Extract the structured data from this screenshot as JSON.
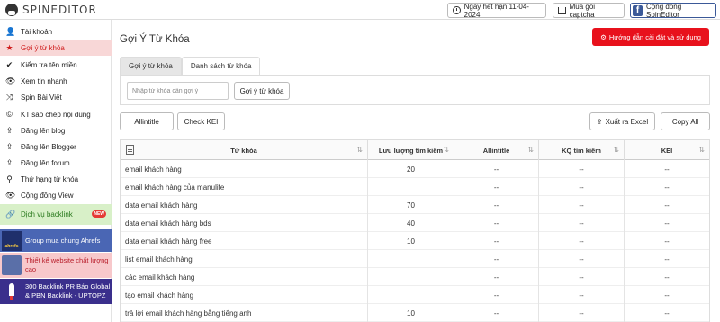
{
  "header": {
    "logo_text": "SPINEDITOR",
    "expire_label": "Ngày hết hạn 11-04-2024",
    "captcha_label": "Mua gói captcha",
    "community_label": "Cộng đồng SpinEditor",
    "fb_glyph": "f"
  },
  "sidebar": {
    "items": [
      {
        "label": "Tài khoản",
        "icon": "user-icon",
        "glyph": "👤"
      },
      {
        "label": "Gợi ý từ khóa",
        "icon": "star-icon",
        "glyph": "★",
        "active": true
      },
      {
        "label": "Kiểm tra tên miền",
        "icon": "check-icon",
        "glyph": "✔"
      },
      {
        "label": "Xem tin nhanh",
        "icon": "eye-icon",
        "glyph": "👁"
      },
      {
        "label": "Spin Bài Viết",
        "icon": "shuffle-icon",
        "glyph": "⤨"
      },
      {
        "label": "KT sao chép nội dung",
        "icon": "copyright-icon",
        "glyph": "©"
      },
      {
        "label": "Đăng lên blog",
        "icon": "upload-icon",
        "glyph": "⇪"
      },
      {
        "label": "Đăng lên Blogger",
        "icon": "upload-icon",
        "glyph": "⇪"
      },
      {
        "label": "Đăng lên forum",
        "icon": "upload-icon",
        "glyph": "⇪"
      },
      {
        "label": "Thứ hạng từ khóa",
        "icon": "search-icon",
        "glyph": "⚲"
      },
      {
        "label": "Cộng đồng View",
        "icon": "eye-icon",
        "glyph": "👁"
      }
    ],
    "backlink_label": "Dịch vụ backlink",
    "new_badge": "NEW",
    "promo_ahrefs": "Group mua chung Ahrefs",
    "promo_ahrefs_thumb": "ahrefs",
    "promo_web": "Thiết kế website chất lượng cao",
    "promo_backlink": "300 Backlink PR Báo Global & PBN Backlink - UPTOPZ"
  },
  "main": {
    "title": "Gợi Ý Từ Khóa",
    "help_label": "Hướng dẫn cài đặt và sử dụng",
    "tabs": [
      {
        "label": "Gợi ý từ khóa",
        "active": true
      },
      {
        "label": "Danh sách từ khóa",
        "active": false
      }
    ],
    "search_placeholder": "Nhập từ khóa cần gợi ý",
    "suggest_button": "Gợi ý từ khóa",
    "allintitle_button": "Allintitle",
    "check_kei_button": "Check KEI",
    "export_button": "Xuất ra Excel",
    "copy_button": "Copy All"
  },
  "table": {
    "headers": [
      "Từ khóa",
      "Lưu lượng tìm kiếm",
      "Allintitle",
      "KQ tìm kiếm",
      "KEI"
    ],
    "rows": [
      {
        "keyword": "email khách hàng",
        "volume": "20",
        "allintitle": "--",
        "kq": "--",
        "kei": "--"
      },
      {
        "keyword": "email khách hàng của manulife",
        "volume": "",
        "allintitle": "--",
        "kq": "--",
        "kei": "--"
      },
      {
        "keyword": "data email khách hàng",
        "volume": "70",
        "allintitle": "--",
        "kq": "--",
        "kei": "--"
      },
      {
        "keyword": "data email khách hàng bds",
        "volume": "40",
        "allintitle": "--",
        "kq": "--",
        "kei": "--"
      },
      {
        "keyword": "data email khách hàng free",
        "volume": "10",
        "allintitle": "--",
        "kq": "--",
        "kei": "--"
      },
      {
        "keyword": "list email khách hàng",
        "volume": "",
        "allintitle": "--",
        "kq": "--",
        "kei": "--"
      },
      {
        "keyword": "các email khách hàng",
        "volume": "",
        "allintitle": "--",
        "kq": "--",
        "kei": "--"
      },
      {
        "keyword": "tạo email khách hàng",
        "volume": "",
        "allintitle": "--",
        "kq": "--",
        "kei": "--"
      },
      {
        "keyword": "trả lời email khách hàng bằng tiếng anh",
        "volume": "10",
        "allintitle": "--",
        "kq": "--",
        "kei": "--"
      }
    ]
  },
  "colors": {
    "accent_red": "#e8111c",
    "active_bg": "#f8d7d7",
    "facebook": "#3b5998",
    "backlink_bg": "#d8f0c8",
    "ahrefs_bg": "#4a66b4",
    "web_bg": "#f7c8cb",
    "uptopz_bg": "#3a2f8c"
  }
}
